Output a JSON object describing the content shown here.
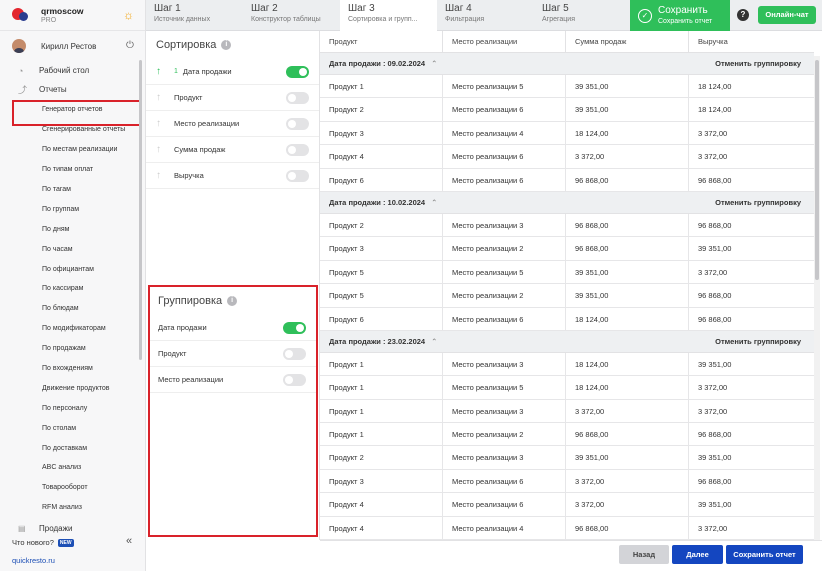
{
  "brand": {
    "name": "qrmoscow",
    "plan": "PRO"
  },
  "user": {
    "name": "Кирилл Рестов"
  },
  "nav": {
    "desktop": "Рабочий стол",
    "reports": "Отчеты",
    "sales": "Продажи",
    "whats_new": "Что нового?",
    "new_badge": "NEW",
    "site_link": "quickresto.ru"
  },
  "submenu": [
    "Генератор отчетов",
    "Сгенерированные отчеты",
    "По местам реализации",
    "По типам оплат",
    "По тагам",
    "По группам",
    "По дням",
    "По часам",
    "По официантам",
    "По кассирам",
    "По блюдам",
    "По модификаторам",
    "По продажам",
    "По вхождениям",
    "Движение продуктов",
    "По персоналу",
    "По столам",
    "По доставкам",
    "ABC анализ",
    "Товарооборот",
    "RFM анализ"
  ],
  "steps": [
    {
      "title": "Шаг 1",
      "subtitle": "Источник данных"
    },
    {
      "title": "Шаг 2",
      "subtitle": "Конструктор таблицы"
    },
    {
      "title": "Шаг 3",
      "subtitle": "Сортировка и групп..."
    },
    {
      "title": "Шаг 4",
      "subtitle": "Фильтрация"
    },
    {
      "title": "Шаг 5",
      "subtitle": "Агрегация"
    }
  ],
  "save_step": {
    "title": "Сохранить",
    "subtitle": "Сохранить отчет"
  },
  "header": {
    "help": "?",
    "chat": "Онлайн-чат"
  },
  "sorting": {
    "title": "Сортировка",
    "items": [
      {
        "label": "Дата продажи",
        "order": "1",
        "on": true
      },
      {
        "label": "Продукт",
        "order": "",
        "on": false
      },
      {
        "label": "Место реализации",
        "order": "",
        "on": false
      },
      {
        "label": "Сумма продаж",
        "order": "",
        "on": false
      },
      {
        "label": "Выручка",
        "order": "",
        "on": false
      }
    ]
  },
  "grouping": {
    "title": "Группировка",
    "items": [
      {
        "label": "Дата продажи",
        "on": true
      },
      {
        "label": "Продукт",
        "on": false
      },
      {
        "label": "Место реализации",
        "on": false
      }
    ]
  },
  "table": {
    "columns": [
      "Продукт",
      "Место реализации",
      "Сумма продаж",
      "Выручка"
    ],
    "cancel_label": "Отменить группировку",
    "groups": [
      {
        "label": "Дата продажи : 09.02.2024",
        "rows": [
          [
            "Продукт 1",
            "Место реализации 5",
            "39 351,00",
            "18 124,00"
          ],
          [
            "Продукт 2",
            "Место реализации 6",
            "39 351,00",
            "18 124,00"
          ],
          [
            "Продукт 3",
            "Место реализации 4",
            "18 124,00",
            "3 372,00"
          ],
          [
            "Продукт 4",
            "Место реализации 6",
            "3 372,00",
            "3 372,00"
          ],
          [
            "Продукт 6",
            "Место реализации 6",
            "96 868,00",
            "96 868,00"
          ]
        ]
      },
      {
        "label": "Дата продажи : 10.02.2024",
        "rows": [
          [
            "Продукт 2",
            "Место реализации 3",
            "96 868,00",
            "96 868,00"
          ],
          [
            "Продукт 3",
            "Место реализации 2",
            "96 868,00",
            "39 351,00"
          ],
          [
            "Продукт 5",
            "Место реализации 5",
            "39 351,00",
            "3 372,00"
          ],
          [
            "Продукт 5",
            "Место реализации 2",
            "39 351,00",
            "96 868,00"
          ],
          [
            "Продукт 6",
            "Место реализации 6",
            "18 124,00",
            "96 868,00"
          ]
        ]
      },
      {
        "label": "Дата продажи : 23.02.2024",
        "rows": [
          [
            "Продукт 1",
            "Место реализации 3",
            "18 124,00",
            "39 351,00"
          ],
          [
            "Продукт 1",
            "Место реализации 5",
            "18 124,00",
            "3 372,00"
          ],
          [
            "Продукт 1",
            "Место реализации 3",
            "3 372,00",
            "3 372,00"
          ],
          [
            "Продукт 1",
            "Место реализации 2",
            "96 868,00",
            "96 868,00"
          ],
          [
            "Продукт 2",
            "Место реализации 3",
            "39 351,00",
            "39 351,00"
          ],
          [
            "Продукт 3",
            "Место реализации 6",
            "3 372,00",
            "96 868,00"
          ],
          [
            "Продукт 4",
            "Место реализации 6",
            "3 372,00",
            "39 351,00"
          ],
          [
            "Продукт 4",
            "Место реализации 4",
            "96 868,00",
            "3 372,00"
          ]
        ]
      }
    ]
  },
  "footer": {
    "back": "Назад",
    "next": "Далее",
    "save": "Сохранить отчет"
  },
  "colors": {
    "accent_green": "#2fbf5a",
    "primary_blue": "#1446c0",
    "highlight_red": "#d9222a"
  }
}
